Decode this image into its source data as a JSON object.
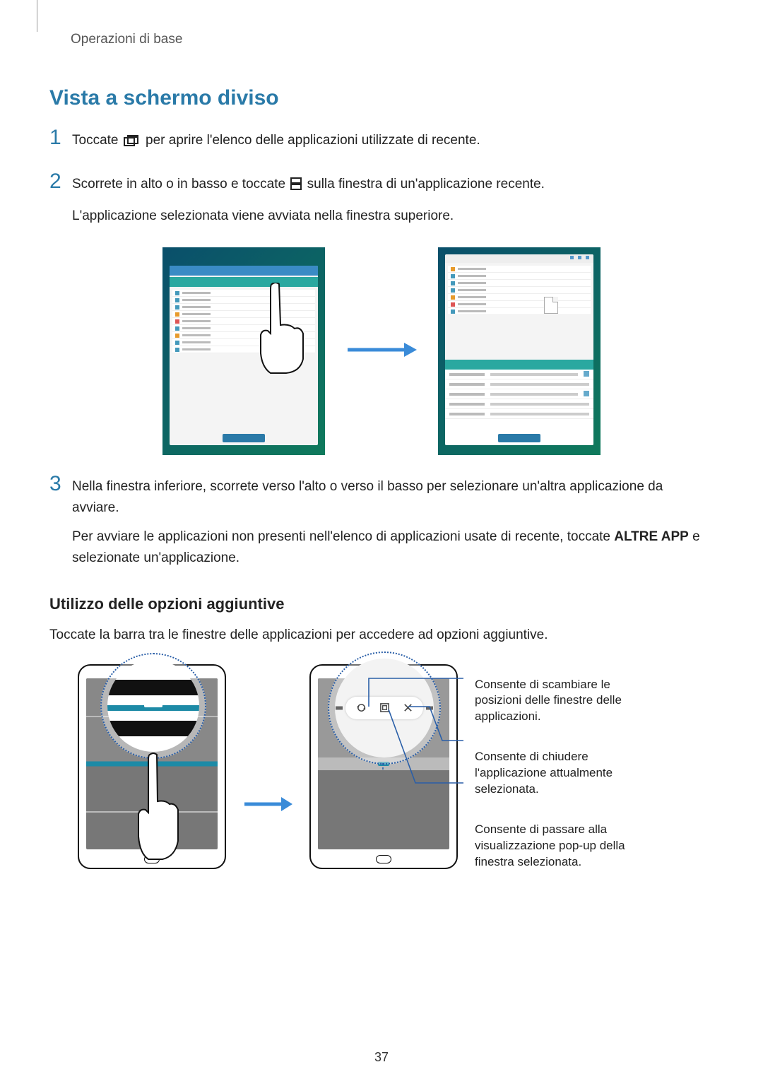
{
  "header": {
    "breadcrumb": "Operazioni di base"
  },
  "section": {
    "title": "Vista a schermo diviso"
  },
  "steps": {
    "s1": {
      "num": "1",
      "pre": "Toccate ",
      "post": " per aprire l'elenco delle applicazioni utilizzate di recente."
    },
    "s2": {
      "num": "2",
      "line1a": "Scorrete in alto o in basso e toccate ",
      "line1b": " sulla finestra di un'applicazione recente.",
      "line2": "L'applicazione selezionata viene avviata nella finestra superiore."
    },
    "s3": {
      "num": "3",
      "line1": "Nella finestra inferiore, scorrete verso l'alto o verso il basso per selezionare un'altra applicazione da avviare.",
      "line2a": "Per avviare le applicazioni non presenti nell'elenco di applicazioni usate di recente, toccate ",
      "line2bold": "ALTRE APP",
      "line2b": " e selezionate un'applicazione."
    }
  },
  "subsection": {
    "title": "Utilizzo delle opzioni aggiuntive",
    "intro": "Toccate la barra tra le finestre delle applicazioni per accedere ad opzioni aggiuntive."
  },
  "callouts": {
    "c1": "Consente di scambiare le posizioni delle finestre delle applicazioni.",
    "c2": "Consente di chiudere l'applicazione attualmente selezionata.",
    "c3": "Consente di passare alla visualizzazione pop-up della finestra selezionata."
  },
  "page_number": "37"
}
